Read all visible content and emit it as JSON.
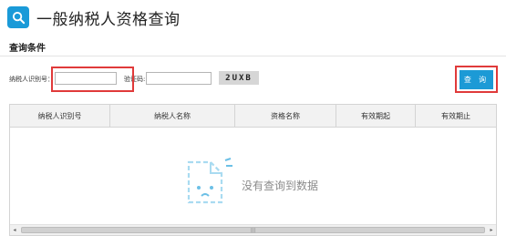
{
  "header": {
    "title": "一般纳税人资格查询",
    "icon": "search-icon",
    "accent": "#1a9ad8"
  },
  "section": {
    "title": "查询条件"
  },
  "form": {
    "taxid_label": "纳税人识别号：",
    "taxid_value": "",
    "captcha_label": "验证码:",
    "captcha_value": "",
    "captcha_text": "2UXB",
    "query_label": "查 询"
  },
  "table": {
    "columns": [
      "纳税人识别号",
      "纳税人名称",
      "资格名称",
      "有效期起",
      "有效期止"
    ],
    "rows": [],
    "empty_text": "没有查询到数据"
  },
  "scrollbar": {
    "left_arrow": "◂",
    "right_arrow": "▸",
    "thumb_grip": "|||"
  },
  "colors": {
    "highlight": "#e03a3a",
    "button": "#1c9ad6"
  }
}
